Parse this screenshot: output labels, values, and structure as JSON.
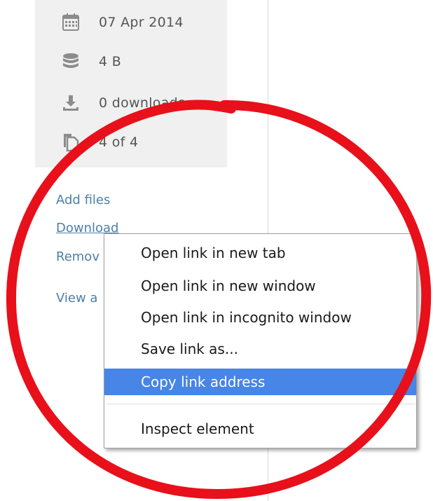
{
  "file_info": {
    "date": "07 Apr 2014",
    "size": "4 B",
    "downloads": "0 downloads",
    "pages": "4 of 4"
  },
  "links": {
    "add_files": "Add files",
    "download": "Download",
    "remove": "Remov",
    "view_all": "View a"
  },
  "context_menu": {
    "items": [
      {
        "label": "Open link in new tab"
      },
      {
        "label": "Open link in new window"
      },
      {
        "label": "Open link in incognito window"
      },
      {
        "label": "Save link as..."
      },
      {
        "label": "Copy link address",
        "highlighted": true
      },
      {
        "label": "Inspect element"
      }
    ]
  },
  "colors": {
    "panel_bg": "#f0f0f0",
    "link": "#4d7fa8",
    "menu_highlight": "#4785e6",
    "annotation_circle": "#e8101a"
  },
  "icons": [
    "calendar-icon",
    "database-icon",
    "download-icon",
    "copy-pages-icon"
  ]
}
